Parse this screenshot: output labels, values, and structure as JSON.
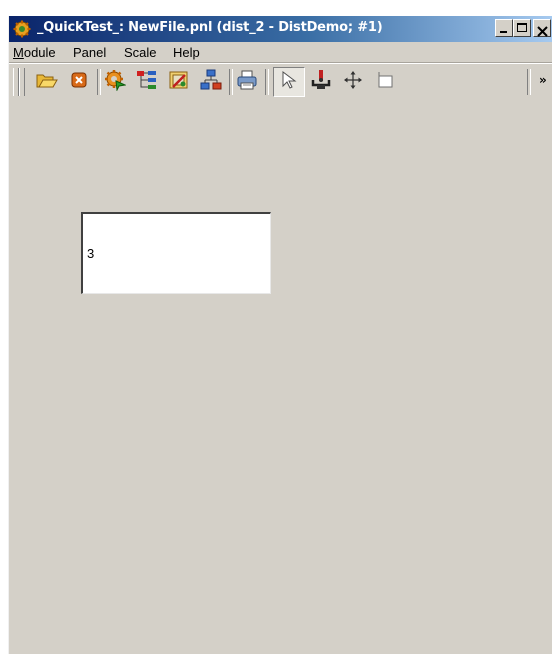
{
  "window": {
    "title": "_QuickTest_: NewFile.pnl (dist_2 - DistDemo; #1)"
  },
  "menu": {
    "items": [
      {
        "label_underlined": "M",
        "label_rest": "odule"
      },
      {
        "label_underlined": "",
        "label_rest": "Panel"
      },
      {
        "label_underlined": "",
        "label_rest": "Scale"
      },
      {
        "label_underlined": "",
        "label_rest": "Help"
      }
    ]
  },
  "toolbar": {
    "icons": [
      "open-folder-icon",
      "close-file-icon",
      "gear-run-icon",
      "tree-view-icon",
      "image-edit-icon",
      "hierarchy-icon",
      "print-icon",
      "select-pointer-icon",
      "anchor-icon",
      "move-icon",
      "resize-icon"
    ],
    "active_tool": "select-pointer-icon",
    "overflow_label": "»"
  },
  "canvas": {
    "value_box_text": "3"
  },
  "colors": {
    "title_gradient_start": "#0a246a",
    "title_gradient_end": "#a6caf0",
    "face": "#d4d0c8"
  }
}
